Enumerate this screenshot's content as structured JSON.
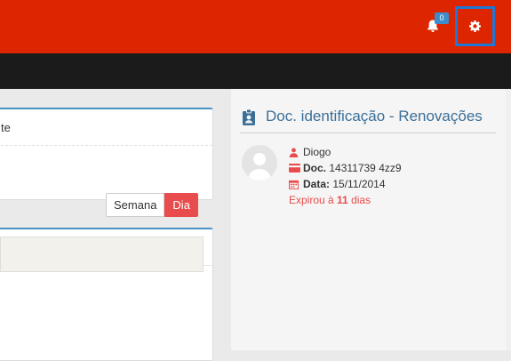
{
  "header": {
    "notification_count": "0",
    "notifications_icon": "bell-icon",
    "settings_icon": "gear-icon",
    "colors": {
      "topbar": "#dd2500",
      "navbar": "#1b1b1b",
      "settings_highlight": "#1f77d6"
    }
  },
  "left_panels": {
    "panel1_text": "te",
    "calendar_buttons": {
      "week": "Semana",
      "day": "Dia"
    }
  },
  "documents": {
    "title": "Doc. identificação - Renovações",
    "title_icon": "id-badge-icon",
    "entry": {
      "name": "Diogo",
      "doc_label": "Doc.",
      "doc_value": "14311739 4zz9",
      "date_label": "Data:",
      "date_value": "15/11/2014",
      "expired_prefix": "Expirou à",
      "expired_days": "11",
      "expired_suffix": "dias"
    }
  }
}
